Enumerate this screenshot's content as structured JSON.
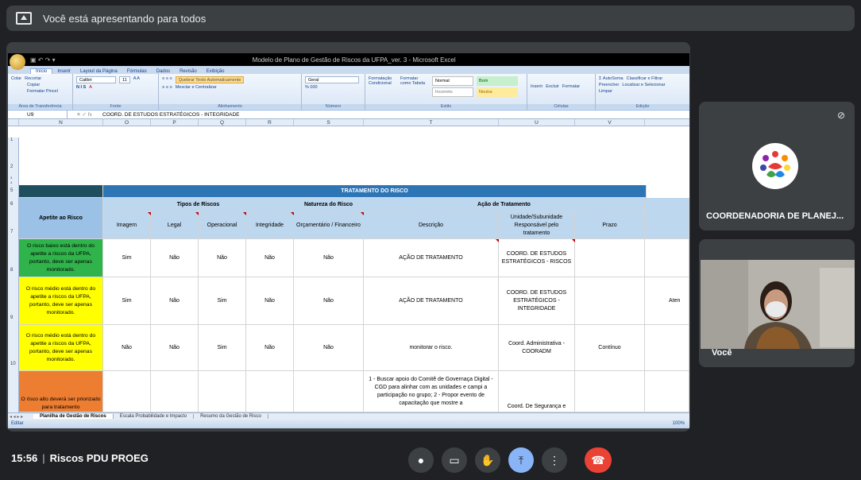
{
  "banner": {
    "text": "Você está apresentando para todos"
  },
  "excel": {
    "qat": "▣ ↶ ↷ ▾",
    "window_title": "Modelo de Plano de Gestão de Riscos da UFPA_ver. 3 - Microsoft Excel",
    "tabs": [
      "Início",
      "Inserir",
      "Layout da Página",
      "Fórmulas",
      "Dados",
      "Revisão",
      "Exibição"
    ],
    "ribbon": {
      "clipboard": {
        "paste": "Colar",
        "cut": "Recortar",
        "copy": "Copiar",
        "format_painter": "Formatar Pincel",
        "label": "Área de Transferência"
      },
      "font": {
        "name": "Calibri",
        "size": "11",
        "label": "Fonte",
        "biu": "N I S"
      },
      "alignment": {
        "wrap": "Quebrar Texto Automaticamente",
        "merge": "Mesclar e Centralizar",
        "label": "Alinhamento"
      },
      "number": {
        "format": "Geral",
        "sym": "% 000",
        "label": "Número"
      },
      "styles": {
        "cond": "Formatação Condicional",
        "table": "Formatar como Tabela",
        "normal": "Normal",
        "bom": "Bom",
        "incorreto": "Incorreto",
        "neutra": "Neutra",
        "label": "Estilo"
      },
      "cells": {
        "insert": "Inserir",
        "delete": "Excluir",
        "format": "Formatar",
        "label": "Células"
      },
      "editing": {
        "autosum": "Σ AutoSoma",
        "fill": "Preencher",
        "clear": "Limpar",
        "sort": "Classificar e Filtrar",
        "find": "Localizar e Selecionar",
        "label": "Edição"
      }
    },
    "formula_bar": {
      "name_box": "U9",
      "fx": "✕ ✓ fx",
      "content": "COORD. DE ESTUDOS ESTRATÉGICOS - INTEGRIDADE"
    },
    "columns": [
      "N",
      "O",
      "P",
      "Q",
      "R",
      "S",
      "T",
      "U",
      "V"
    ],
    "row_numbers": [
      "1",
      "2",
      "3",
      "4",
      "5",
      "6",
      "7",
      "8",
      "9",
      "10"
    ],
    "table": {
      "title": "TRATAMENTO DO RISCO",
      "apetite_header": "Apetite ao Risco",
      "tipos_header": "Tipos de Riscos",
      "natureza_header": "Natureza do Risco",
      "acao_header": "Ação de Tratamento",
      "col_imagem": "Imagem",
      "col_legal": "Legal",
      "col_operacional": "Operacional",
      "col_integridade": "Integridade",
      "col_orcamentario": "Orçamentário / Financeiro",
      "col_descricao": "Descrição",
      "col_unidade": "Unidade/Subunidade Responsável pelo tratamento",
      "col_prazo": "Prazo",
      "rows": [
        {
          "apetite": "O risco baixo está dentro do apetite a riscos da UFPA, portanto, deve ser apenas monitorado.",
          "imagem": "Sim",
          "legal": "Não",
          "operacional": "Não",
          "integridade": "Não",
          "orcamentario": "Não",
          "descricao": "AÇÃO DE TRATAMENTO",
          "unidade": "COORD. DE ESTUDOS ESTRATÉGICOS - RISCOS",
          "prazo": "",
          "extra": ""
        },
        {
          "apetite": "O risco médio está dentro do apetite a riscos da UFPA, portanto, deve ser apenas monitorado.",
          "imagem": "Sim",
          "legal": "Não",
          "operacional": "Sim",
          "integridade": "Não",
          "orcamentario": "Não",
          "descricao": "AÇÃO DE TRATAMENTO",
          "unidade": "COORD. DE ESTUDOS ESTRATÉGICOS - INTEGRIDADE",
          "prazo": "",
          "extra": "Aten"
        },
        {
          "apetite": "O risco médio está dentro do apetite a riscos da UFPA, portanto, deve ser apenas monitorado.",
          "imagem": "Não",
          "legal": "Não",
          "operacional": "Sim",
          "integridade": "Não",
          "orcamentario": "Não",
          "descricao": "monitorar o risco.",
          "unidade": "Coord. Administrativa - COORADM",
          "prazo": "Contínuo",
          "extra": ""
        },
        {
          "apetite": "O risco alto deverá ser priorizado para tratamento",
          "imagem": "",
          "legal": "",
          "operacional": "",
          "integridade": "",
          "orcamentario": "",
          "descricao": "1 - Buscar apoio do Comitê de Governaça Digital - CGD para alinhar com as unidades e campi a participação no grupo; 2 - Propor evento de capacitação que mostre a",
          "unidade": "Coord. De Segurança e",
          "prazo": "",
          "extra": ""
        }
      ]
    },
    "sheets": [
      "Planilha de Gestão de Riscos",
      "Escala Probabilidade e Impacto",
      "Resumo da Gestão de Risco"
    ],
    "sheet_nav": "◂ ◂ ▸ ▸",
    "status": "Editar",
    "zoom": "100%"
  },
  "participants": {
    "tile1_name": "COORDENADORIA DE PLANEJ...",
    "tile2_name": "Você"
  },
  "bottom": {
    "time": "15:56",
    "meeting": "Riscos PDU PROEG"
  },
  "icons": {
    "mic_off": "🎙",
    "mic": "🎙",
    "cam": "▭",
    "hand": "✋",
    "present": "⤒",
    "more": "⋮",
    "end": "☎"
  },
  "colors": {
    "accent": "#8ab4f8",
    "end_call": "#ea4335",
    "header_blue": "#2e75b6",
    "green": "#2fb34a",
    "yellow": "#ffff00",
    "orange": "#ed7d31"
  }
}
